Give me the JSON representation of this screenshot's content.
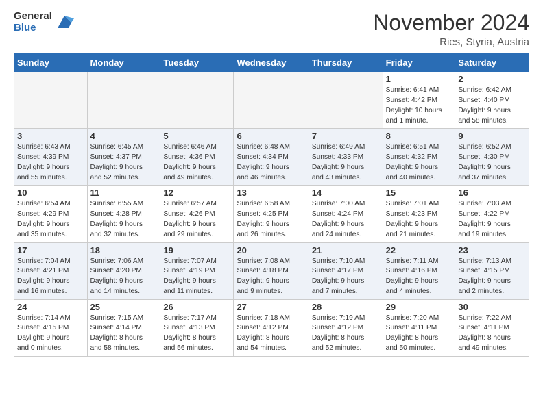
{
  "header": {
    "logo_general": "General",
    "logo_blue": "Blue",
    "month": "November 2024",
    "location": "Ries, Styria, Austria"
  },
  "days_of_week": [
    "Sunday",
    "Monday",
    "Tuesday",
    "Wednesday",
    "Thursday",
    "Friday",
    "Saturday"
  ],
  "weeks": [
    [
      {
        "day": "",
        "info": ""
      },
      {
        "day": "",
        "info": ""
      },
      {
        "day": "",
        "info": ""
      },
      {
        "day": "",
        "info": ""
      },
      {
        "day": "",
        "info": ""
      },
      {
        "day": "1",
        "info": "Sunrise: 6:41 AM\nSunset: 4:42 PM\nDaylight: 10 hours\nand 1 minute."
      },
      {
        "day": "2",
        "info": "Sunrise: 6:42 AM\nSunset: 4:40 PM\nDaylight: 9 hours\nand 58 minutes."
      }
    ],
    [
      {
        "day": "3",
        "info": "Sunrise: 6:43 AM\nSunset: 4:39 PM\nDaylight: 9 hours\nand 55 minutes."
      },
      {
        "day": "4",
        "info": "Sunrise: 6:45 AM\nSunset: 4:37 PM\nDaylight: 9 hours\nand 52 minutes."
      },
      {
        "day": "5",
        "info": "Sunrise: 6:46 AM\nSunset: 4:36 PM\nDaylight: 9 hours\nand 49 minutes."
      },
      {
        "day": "6",
        "info": "Sunrise: 6:48 AM\nSunset: 4:34 PM\nDaylight: 9 hours\nand 46 minutes."
      },
      {
        "day": "7",
        "info": "Sunrise: 6:49 AM\nSunset: 4:33 PM\nDaylight: 9 hours\nand 43 minutes."
      },
      {
        "day": "8",
        "info": "Sunrise: 6:51 AM\nSunset: 4:32 PM\nDaylight: 9 hours\nand 40 minutes."
      },
      {
        "day": "9",
        "info": "Sunrise: 6:52 AM\nSunset: 4:30 PM\nDaylight: 9 hours\nand 37 minutes."
      }
    ],
    [
      {
        "day": "10",
        "info": "Sunrise: 6:54 AM\nSunset: 4:29 PM\nDaylight: 9 hours\nand 35 minutes."
      },
      {
        "day": "11",
        "info": "Sunrise: 6:55 AM\nSunset: 4:28 PM\nDaylight: 9 hours\nand 32 minutes."
      },
      {
        "day": "12",
        "info": "Sunrise: 6:57 AM\nSunset: 4:26 PM\nDaylight: 9 hours\nand 29 minutes."
      },
      {
        "day": "13",
        "info": "Sunrise: 6:58 AM\nSunset: 4:25 PM\nDaylight: 9 hours\nand 26 minutes."
      },
      {
        "day": "14",
        "info": "Sunrise: 7:00 AM\nSunset: 4:24 PM\nDaylight: 9 hours\nand 24 minutes."
      },
      {
        "day": "15",
        "info": "Sunrise: 7:01 AM\nSunset: 4:23 PM\nDaylight: 9 hours\nand 21 minutes."
      },
      {
        "day": "16",
        "info": "Sunrise: 7:03 AM\nSunset: 4:22 PM\nDaylight: 9 hours\nand 19 minutes."
      }
    ],
    [
      {
        "day": "17",
        "info": "Sunrise: 7:04 AM\nSunset: 4:21 PM\nDaylight: 9 hours\nand 16 minutes."
      },
      {
        "day": "18",
        "info": "Sunrise: 7:06 AM\nSunset: 4:20 PM\nDaylight: 9 hours\nand 14 minutes."
      },
      {
        "day": "19",
        "info": "Sunrise: 7:07 AM\nSunset: 4:19 PM\nDaylight: 9 hours\nand 11 minutes."
      },
      {
        "day": "20",
        "info": "Sunrise: 7:08 AM\nSunset: 4:18 PM\nDaylight: 9 hours\nand 9 minutes."
      },
      {
        "day": "21",
        "info": "Sunrise: 7:10 AM\nSunset: 4:17 PM\nDaylight: 9 hours\nand 7 minutes."
      },
      {
        "day": "22",
        "info": "Sunrise: 7:11 AM\nSunset: 4:16 PM\nDaylight: 9 hours\nand 4 minutes."
      },
      {
        "day": "23",
        "info": "Sunrise: 7:13 AM\nSunset: 4:15 PM\nDaylight: 9 hours\nand 2 minutes."
      }
    ],
    [
      {
        "day": "24",
        "info": "Sunrise: 7:14 AM\nSunset: 4:15 PM\nDaylight: 9 hours\nand 0 minutes."
      },
      {
        "day": "25",
        "info": "Sunrise: 7:15 AM\nSunset: 4:14 PM\nDaylight: 8 hours\nand 58 minutes."
      },
      {
        "day": "26",
        "info": "Sunrise: 7:17 AM\nSunset: 4:13 PM\nDaylight: 8 hours\nand 56 minutes."
      },
      {
        "day": "27",
        "info": "Sunrise: 7:18 AM\nSunset: 4:12 PM\nDaylight: 8 hours\nand 54 minutes."
      },
      {
        "day": "28",
        "info": "Sunrise: 7:19 AM\nSunset: 4:12 PM\nDaylight: 8 hours\nand 52 minutes."
      },
      {
        "day": "29",
        "info": "Sunrise: 7:20 AM\nSunset: 4:11 PM\nDaylight: 8 hours\nand 50 minutes."
      },
      {
        "day": "30",
        "info": "Sunrise: 7:22 AM\nSunset: 4:11 PM\nDaylight: 8 hours\nand 49 minutes."
      }
    ]
  ]
}
